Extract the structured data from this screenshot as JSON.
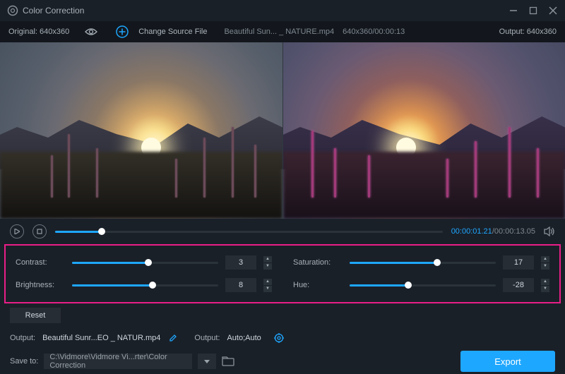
{
  "titlebar": {
    "title": "Color Correction"
  },
  "infobar": {
    "original_label": "Original: 640x360",
    "change_source": "Change Source File",
    "filename": "Beautiful Sun... _ NATURE.mp4",
    "dims_time": "640x360/00:00:13",
    "output_label": "Output: 640x360"
  },
  "playbar": {
    "current": "00:00:01.21",
    "total": "00:00:13.05",
    "seek_pct": 12
  },
  "sliders": {
    "contrast": {
      "label": "Contrast:",
      "value": "3",
      "pct": 52
    },
    "brightness": {
      "label": "Brightness:",
      "value": "8",
      "pct": 55
    },
    "saturation": {
      "label": "Saturation:",
      "value": "17",
      "pct": 60
    },
    "hue": {
      "label": "Hue:",
      "value": "-28",
      "pct": 40
    }
  },
  "buttons": {
    "reset": "Reset",
    "export": "Export"
  },
  "output": {
    "label1": "Output:",
    "filename": "Beautiful Sunr...EO _ NATUR.mp4",
    "label2": "Output:",
    "setting": "Auto;Auto"
  },
  "save": {
    "label": "Save to:",
    "path": "C:\\Vidmore\\Vidmore Vi...rter\\Color Correction"
  }
}
